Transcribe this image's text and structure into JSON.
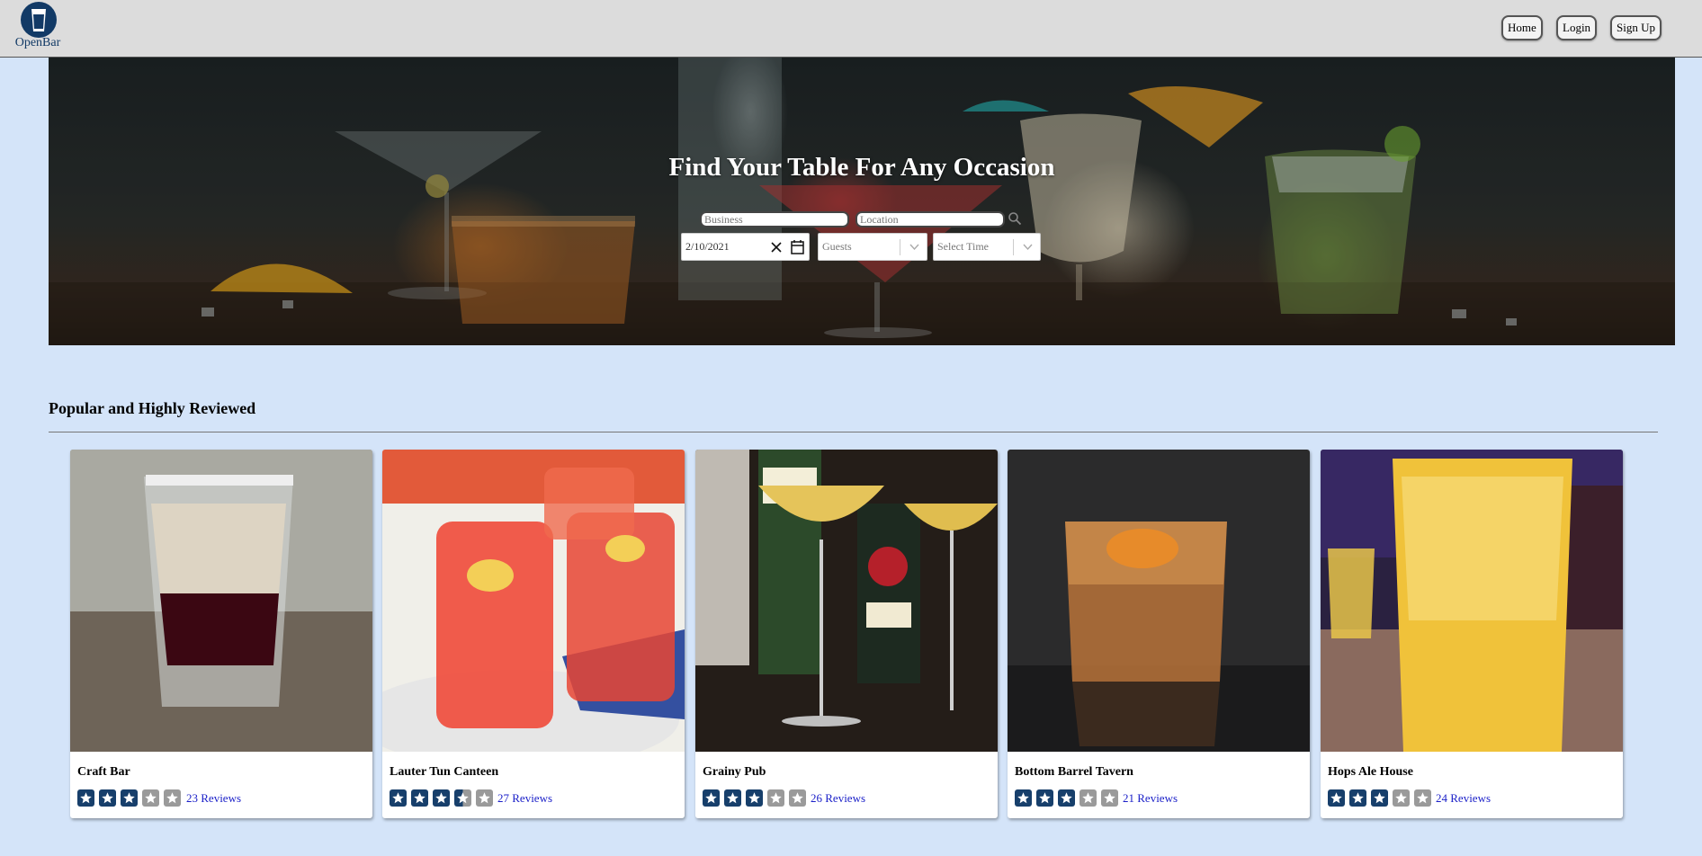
{
  "brand": {
    "name": "OpenBar"
  },
  "nav": {
    "home": "Home",
    "login": "Login",
    "signup": "Sign Up"
  },
  "hero": {
    "title": "Find Your Table For Any Occasion",
    "business_placeholder": "Business",
    "location_placeholder": "Location",
    "date_value": "2/10/2021",
    "guests_placeholder": "Guests",
    "time_placeholder": "Select Time"
  },
  "section": {
    "title": "Popular and Highly Reviewed"
  },
  "colors": {
    "brand": "#123a66",
    "star_filled": "#173f6b",
    "star_empty": "#9a9a9a",
    "link": "#1a1fc8"
  },
  "bars": [
    {
      "name": "Craft Bar",
      "rating": 3,
      "reviews": "23 Reviews"
    },
    {
      "name": "Lauter Tun Canteen",
      "rating": 3.5,
      "reviews": "27 Reviews"
    },
    {
      "name": "Grainy Pub",
      "rating": 3,
      "reviews": "26 Reviews"
    },
    {
      "name": "Bottom Barrel Tavern",
      "rating": 3,
      "reviews": "21 Reviews"
    },
    {
      "name": "Hops Ale House",
      "rating": 3,
      "reviews": "24 Reviews"
    }
  ]
}
